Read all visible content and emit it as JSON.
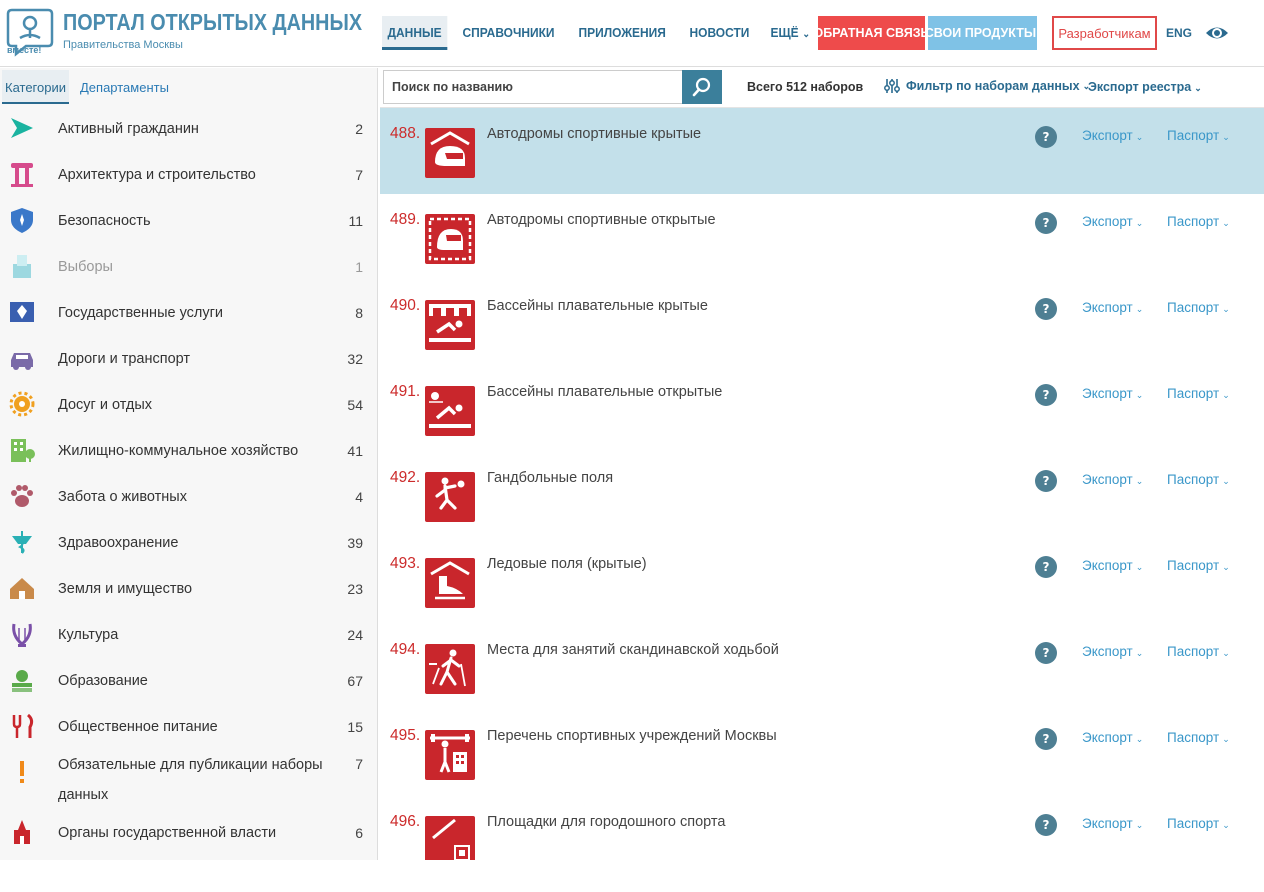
{
  "header": {
    "logo_caption": "вместе!",
    "title": "ПОРТАЛ ОТКРЫТЫХ ДАННЫХ",
    "subtitle": "Правительства Москвы",
    "nav": [
      {
        "label": "ДАННЫЕ"
      },
      {
        "label": "СПРАВОЧНИКИ"
      },
      {
        "label": "ПРИЛОЖЕНИЯ"
      },
      {
        "label": "НОВОСТИ"
      },
      {
        "label": "ЕЩЁ"
      }
    ],
    "feedback_label": "ОБРАТНАЯ СВЯЗЬ",
    "products_label": "СВОИ ПРОДУКТЫ!",
    "developers_label": "Разработчикам",
    "lang_label": "ENG",
    "eye_icon": "eye-icon"
  },
  "sidebar": {
    "tabs": [
      {
        "label": "Категории"
      },
      {
        "label": "Департаменты"
      }
    ],
    "categories": [
      {
        "name": "Активный гражданин",
        "count": "2",
        "icon": "play-arrow-icon",
        "color": "#1ab3a0"
      },
      {
        "name": "Архитектура и строительство",
        "count": "7",
        "icon": "column-icon",
        "color": "#d64b8c"
      },
      {
        "name": "Безопасность",
        "count": "11",
        "icon": "shield-icon",
        "color": "#3a78c9"
      },
      {
        "name": "Выборы",
        "count": "1",
        "icon": "ballot-box-icon",
        "color": "#9dd8e0",
        "dim": true
      },
      {
        "name": "Государственные услуги",
        "count": "8",
        "icon": "coat-of-arms-icon",
        "color": "#3a5fb0"
      },
      {
        "name": "Дороги и транспорт",
        "count": "32",
        "icon": "car-icon",
        "color": "#7a6aa8"
      },
      {
        "name": "Досуг и отдых",
        "count": "54",
        "icon": "sun-gear-icon",
        "color": "#f0a020"
      },
      {
        "name": "Жилищно-коммунальное хозяйство",
        "count": "41",
        "icon": "building-icon",
        "color": "#7ac05a"
      },
      {
        "name": "Забота о животных",
        "count": "4",
        "icon": "paw-icon",
        "color": "#b05a6a"
      },
      {
        "name": "Здравоохранение",
        "count": "39",
        "icon": "health-icon",
        "color": "#2ab0b5"
      },
      {
        "name": "Земля и имущество",
        "count": "23",
        "icon": "house-icon",
        "color": "#c98a4a"
      },
      {
        "name": "Культура",
        "count": "24",
        "icon": "lyre-icon",
        "color": "#7a50a8"
      },
      {
        "name": "Образование",
        "count": "67",
        "icon": "apple-books-icon",
        "color": "#5aaa4a"
      },
      {
        "name": "Общественное питание",
        "count": "15",
        "icon": "fork-knife-icon",
        "color": "#c9262c"
      },
      {
        "name": "Обязательные для публикации наборы данных",
        "count": "7",
        "icon": "exclamation-icon",
        "color": "#f08a1a",
        "tall": true
      },
      {
        "name": "Органы государственной власти",
        "count": "6",
        "icon": "kremlin-icon",
        "color": "#c9262c"
      }
    ]
  },
  "main": {
    "search_placeholder": "Поиск по названию",
    "total_label": "Всего 512 наборов",
    "filter_label": "Фильтр по наборам данных",
    "export_registry_label": "Экспорт реестра",
    "export_label": "Экспорт",
    "passport_label": "Паспорт",
    "help_label": "?",
    "datasets": [
      {
        "num": "488.",
        "title": "Автодромы спортивные крытые",
        "icon": "helmet-indoor-icon",
        "active": true
      },
      {
        "num": "489.",
        "title": "Автодромы спортивные открытые",
        "icon": "helmet-outdoor-icon"
      },
      {
        "num": "490.",
        "title": "Бассейны плавательные крытые",
        "icon": "swimming-indoor-icon"
      },
      {
        "num": "491.",
        "title": "Бассейны плавательные открытые",
        "icon": "swimming-outdoor-icon"
      },
      {
        "num": "492.",
        "title": "Гандбольные поля",
        "icon": "handball-icon"
      },
      {
        "num": "493.",
        "title": "Ледовые поля (крытые)",
        "icon": "skate-icon"
      },
      {
        "num": "494.",
        "title": "Места для занятий скандинавской ходьбой",
        "icon": "nordic-walking-icon"
      },
      {
        "num": "495.",
        "title": "Перечень спортивных учреждений Москвы",
        "icon": "sports-institution-icon"
      },
      {
        "num": "496.",
        "title": "Площадки для городошного спорта",
        "icon": "gorodki-icon"
      }
    ]
  },
  "colors": {
    "brand": "#4a8caf",
    "accent_red": "#c9262c",
    "nav_blue": "#2a6a8f",
    "link_blue": "#3a97c9",
    "active_row": "#c3e0ea"
  }
}
